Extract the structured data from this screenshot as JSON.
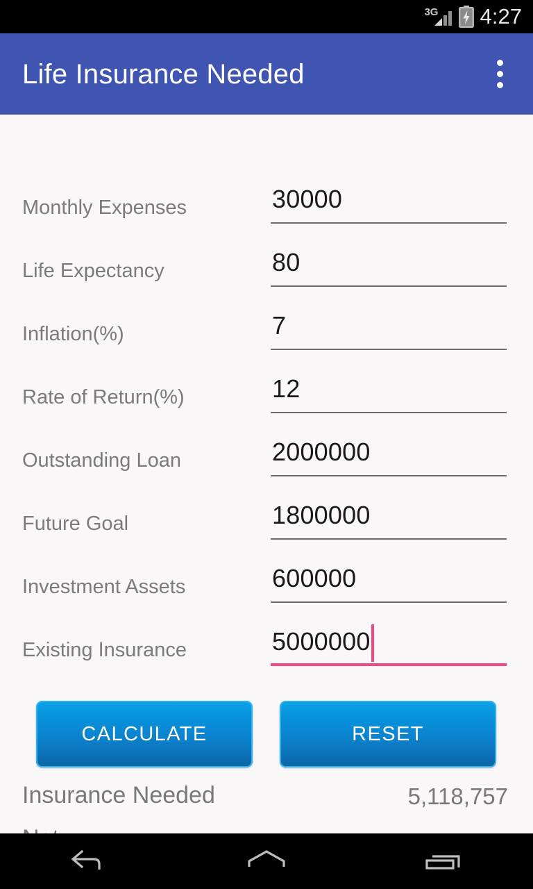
{
  "status_bar": {
    "network_type": "3G",
    "signal_icon": "signal-bars-icon",
    "battery_icon": "battery-charging-icon",
    "time": "4:27"
  },
  "app_bar": {
    "title": "Life Insurance Needed",
    "overflow_icon": "overflow-menu-icon",
    "color": "#4054b2"
  },
  "form": {
    "fields": [
      {
        "label": "Monthly Expenses",
        "value": "30000",
        "focused": false
      },
      {
        "label": "Life Expectancy",
        "value": "80",
        "focused": false
      },
      {
        "label": "Inflation(%)",
        "value": "7",
        "focused": false
      },
      {
        "label": "Rate of Return(%)",
        "value": "12",
        "focused": false
      },
      {
        "label": "Outstanding Loan",
        "value": "2000000",
        "focused": false
      },
      {
        "label": "Future Goal",
        "value": "1800000",
        "focused": false
      },
      {
        "label": "Investment Assets",
        "value": "600000",
        "focused": false
      },
      {
        "label": "Existing Insurance",
        "value": "5000000",
        "focused": true
      }
    ]
  },
  "buttons": {
    "calculate_label": "CALCULATE",
    "reset_label": "RESET",
    "accent_top": "#0aa3e8",
    "accent_bottom": "#0b669f"
  },
  "results": [
    {
      "label": "Insurance Needed",
      "value": "5,118,757"
    },
    {
      "label": "Net",
      "value": ""
    }
  ],
  "nav_bar": {
    "back_icon": "back-arrow-icon",
    "home_icon": "home-icon",
    "recents_icon": "recent-apps-icon"
  }
}
